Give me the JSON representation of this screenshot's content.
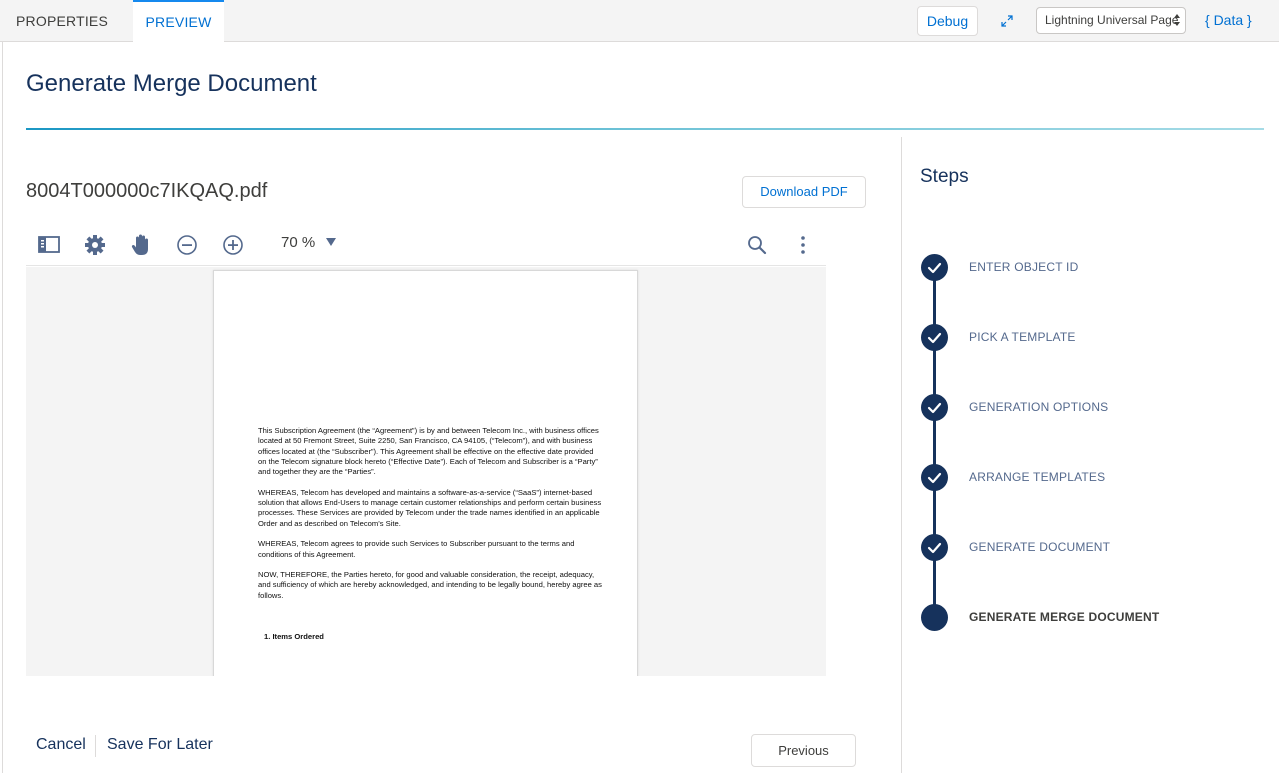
{
  "topbar": {
    "tabs": [
      {
        "label": "PROPERTIES",
        "active": false
      },
      {
        "label": "PREVIEW",
        "active": true
      }
    ],
    "debug_label": "Debug",
    "page_type_select": "Lightning Universal Page",
    "data_link": "{ Data }"
  },
  "page": {
    "title": "Generate Merge Document"
  },
  "document": {
    "filename": "8004T000000c7IKQAQ.pdf",
    "download_label": "Download PDF",
    "zoom": "70 %",
    "paragraphs": [
      "This Subscription Agreement (the “Agreement”) is by and between Telecom Inc., with business offices located at 50 Fremont Street, Suite 2250, San Francisco, CA 94105, (“Telecom”), and  with business offices located at      (the “Subscriber”). This Agreement shall be effective on the effective date provided on the Telecom signature block hereto (“Effective Date”). Each of Telecom and Subscriber is a “Party” and together they are the “Parties”.",
      "WHEREAS, Telecom has developed and maintains a software-as-a-service (“SaaS”) internet-based solution that allows End-Users to manage certain customer relationships and perform certain business processes. These Services are provided by Telecom under the trade names identified in an applicable Order and as described on Telecom’s Site.",
      "WHEREAS, Telecom agrees to provide such Services to Subscriber pursuant to the terms and conditions of this Agreement.",
      "NOW, THEREFORE, the Parties hereto, for good and valuable consideration, the receipt, adequacy, and sufficiency of which are hereby acknowledged, and intending to be legally bound, hereby agree as follows."
    ],
    "heading": "1.   Items Ordered"
  },
  "footer": {
    "cancel_label": "Cancel",
    "save_label": "Save For Later",
    "previous_label": "Previous"
  },
  "steps": {
    "title": "Steps",
    "items": [
      {
        "label": "ENTER OBJECT ID",
        "status": "complete"
      },
      {
        "label": "PICK A TEMPLATE",
        "status": "complete"
      },
      {
        "label": "GENERATION OPTIONS",
        "status": "complete"
      },
      {
        "label": "ARRANGE TEMPLATES",
        "status": "complete"
      },
      {
        "label": "GENERATE DOCUMENT",
        "status": "complete"
      },
      {
        "label": "GENERATE MERGE DOCUMENT",
        "status": "active"
      }
    ]
  },
  "colors": {
    "brand_blue": "#0070d2",
    "navy": "#16325c",
    "accent_teal": "#1b97c4"
  }
}
